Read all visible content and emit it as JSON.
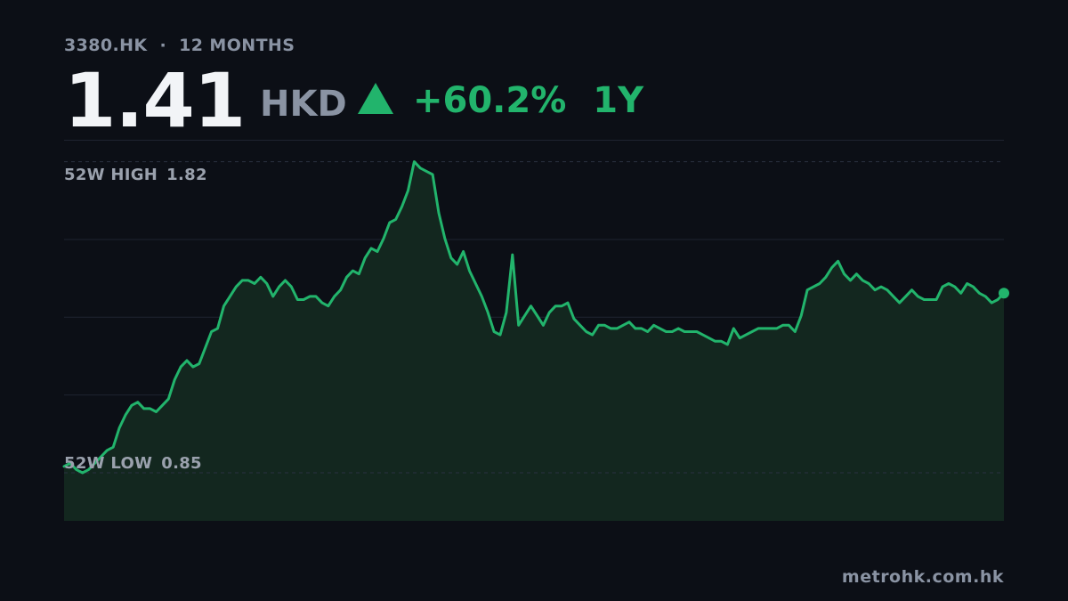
{
  "header": {
    "ticker": "3380.HK",
    "separator": "·",
    "period_label": "12 MONTHS"
  },
  "quote": {
    "price": "1.41",
    "currency": "HKD",
    "change": "+60.2%",
    "change_period": "1Y",
    "direction": "up"
  },
  "reference": {
    "high_label": "52W HIGH",
    "high_value": "1.82",
    "low_label": "52W LOW",
    "low_value": "0.85"
  },
  "footer": {
    "source": "metrohk.com.hk"
  },
  "colors": {
    "background": "#0c0f16",
    "accent": "#22b46c",
    "fill": "#13271f",
    "muted": "#8a93a3",
    "grid": "#1e2330"
  },
  "icons": {
    "direction_icon": "up-triangle-icon"
  },
  "chart_data": {
    "type": "area",
    "x_period": "12 MONTHS",
    "ylim": [
      0.7,
      1.88
    ],
    "reference_lines": [
      {
        "label": "52W HIGH",
        "value": 1.82
      },
      {
        "label": "52W LOW",
        "value": 0.85
      }
    ],
    "grid": true,
    "values": [
      0.87,
      0.88,
      0.86,
      0.85,
      0.86,
      0.88,
      0.9,
      0.92,
      0.93,
      0.99,
      1.03,
      1.06,
      1.07,
      1.05,
      1.05,
      1.04,
      1.06,
      1.08,
      1.14,
      1.18,
      1.2,
      1.18,
      1.19,
      1.24,
      1.29,
      1.3,
      1.37,
      1.4,
      1.43,
      1.45,
      1.45,
      1.44,
      1.46,
      1.44,
      1.4,
      1.43,
      1.45,
      1.43,
      1.39,
      1.39,
      1.4,
      1.4,
      1.38,
      1.37,
      1.4,
      1.42,
      1.46,
      1.48,
      1.47,
      1.52,
      1.55,
      1.54,
      1.58,
      1.63,
      1.64,
      1.68,
      1.73,
      1.82,
      1.8,
      1.79,
      1.78,
      1.66,
      1.58,
      1.52,
      1.5,
      1.54,
      1.48,
      1.44,
      1.4,
      1.35,
      1.29,
      1.28,
      1.35,
      1.53,
      1.31,
      1.34,
      1.37,
      1.34,
      1.31,
      1.35,
      1.37,
      1.37,
      1.38,
      1.33,
      1.31,
      1.29,
      1.28,
      1.31,
      1.31,
      1.3,
      1.3,
      1.31,
      1.32,
      1.3,
      1.3,
      1.29,
      1.31,
      1.3,
      1.29,
      1.29,
      1.3,
      1.29,
      1.29,
      1.29,
      1.28,
      1.27,
      1.26,
      1.26,
      1.25,
      1.3,
      1.27,
      1.28,
      1.29,
      1.3,
      1.3,
      1.3,
      1.3,
      1.31,
      1.31,
      1.29,
      1.34,
      1.42,
      1.43,
      1.44,
      1.46,
      1.49,
      1.51,
      1.47,
      1.45,
      1.47,
      1.45,
      1.44,
      1.42,
      1.43,
      1.42,
      1.4,
      1.38,
      1.4,
      1.42,
      1.4,
      1.39,
      1.39,
      1.39,
      1.43,
      1.44,
      1.43,
      1.41,
      1.44,
      1.43,
      1.41,
      1.4,
      1.38,
      1.39,
      1.41
    ]
  }
}
